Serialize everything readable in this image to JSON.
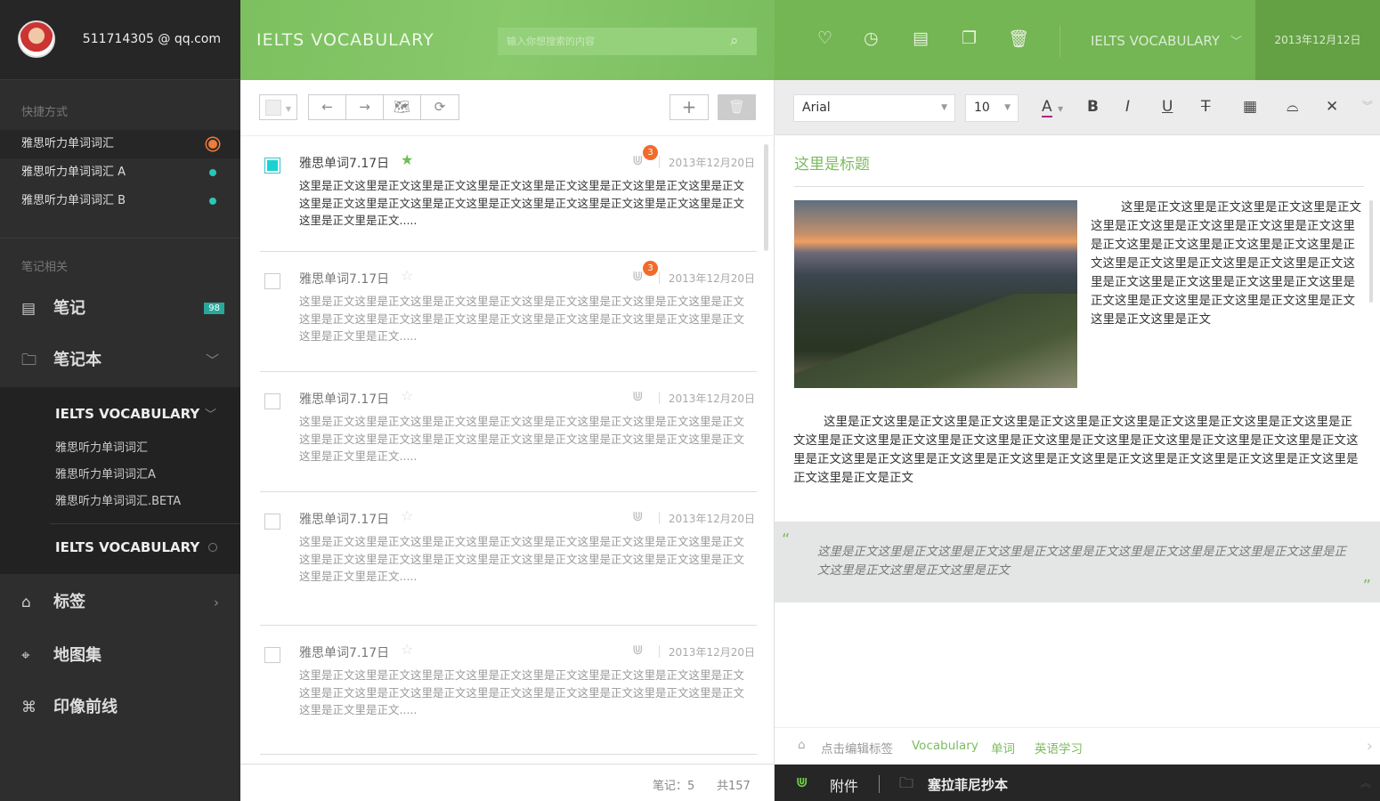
{
  "user": {
    "email": "511714305 @ qq.com"
  },
  "sidebar": {
    "quick_label": "快捷方式",
    "quick_items": [
      {
        "label": "雅思听力单词词汇"
      },
      {
        "label": "雅思听力单词词汇 A"
      },
      {
        "label": "雅思听力单词词汇 B"
      }
    ],
    "notes_label": "笔记相关",
    "notes": {
      "label": "笔记",
      "badge": "98"
    },
    "notebooks": {
      "label": "笔记本"
    },
    "notebook_groups": [
      {
        "title": "IELTS VOCABULARY",
        "items": [
          "雅思听力单词词汇",
          "雅思听力单词词汇A",
          "雅思听力单词词汇.BETA"
        ]
      },
      {
        "title": "IELTS VOCABULARY"
      }
    ],
    "tags": {
      "label": "标签"
    },
    "atlas": {
      "label": "地图集"
    },
    "shortcuts": {
      "label": "印像前线"
    }
  },
  "list": {
    "title": "IELTS VOCABULARY",
    "search_placeholder": "输入你想搜索的内容",
    "notes": [
      {
        "title": "雅思单词7.17日",
        "starred": true,
        "selected": true,
        "attachments": "3",
        "date": "2013年12月20日",
        "body": "这里是正文这里是正文这里是正文这里是正文这里是正文这里是正文这里是正文这里是正文这里是正文这里是正文这里是正文这里是正文这里是正文这里是正文这里是正文这里是正文这里是正文里是正文....."
      },
      {
        "title": "雅思单词7.17日",
        "starred": false,
        "attachments": "3",
        "date": "2013年12月20日",
        "body": "这里是正文这里是正文这里是正文这里是正文这里是正文这里是正文这里是正文这里是正文这里是正文这里是正文这里是正文这里是正文这里是正文这里是正文这里是正文这里是正文这里是正文里是正文....."
      },
      {
        "title": "雅思单词7.17日",
        "starred": false,
        "date": "2013年12月20日",
        "body": "这里是正文这里是正文这里是正文这里是正文这里是正文这里是正文这里是正文这里是正文这里是正文这里是正文这里是正文这里是正文这里是正文这里是正文这里是正文这里是正文这里是正文里是正文....."
      },
      {
        "title": "雅思单词7.17日",
        "starred": false,
        "date": "2013年12月20日",
        "body": "这里是正文这里是正文这里是正文这里是正文这里是正文这里是正文这里是正文这里是正文这里是正文这里是正文这里是正文这里是正文这里是正文这里是正文这里是正文这里是正文这里是正文里是正文....."
      },
      {
        "title": "雅思单词7.17日",
        "starred": false,
        "date": "2013年12月20日",
        "body": "这里是正文这里是正文这里是正文这里是正文这里是正文这里是正文这里是正文这里是正文这里是正文这里是正文这里是正文这里是正文这里是正文这里是正文这里是正文这里是正文这里是正文里是正文....."
      }
    ],
    "footer": {
      "count": "笔记：5",
      "total": "共157"
    }
  },
  "editor": {
    "notebook": "IELTS VOCABULARY",
    "date": "2013年12月12日",
    "font": "Arial",
    "size": "10",
    "title": "这里是标题",
    "p1": "这里是正文这里是正文这里是正文这里是正文这里是正文这里是正文这里是正文这里是正文这里是正文这里是正文这里是正文这里是正文这里是正文这里是正文这里是正文这里是正文这里是正文这里是正文这里是正文这里是正文这里是正文这里是正文这里是正文这里是正文这里是正文这里是正文这里是正文这里是正文",
    "p2": "这里是正文这里是正文这里是正文这里是正文这里是正文这里是正文这里是正文这里是正文这里是正文这里是正文这里是正文这里是正文这里是正文这里是正文这里是正文这里是正文这里是正文这里是正文这里是正文这里是正文这里是正文这里是正文这里是正文这里是正文这里是正文这里是正文这里是正文这里是正文这里是正文是正文",
    "quote": "这里是正文这里是正文这里是正文这里是正文这里是正文这里是正文这里是正文这里是正文这里是正文这里是正文这里是正文这里是正文",
    "tag_hint": "点击编辑标签",
    "tags": [
      "Vocabulary",
      "单词",
      "英语学习"
    ],
    "attach_label": "附件",
    "notebook_footer": "塞拉菲尼抄本"
  },
  "colors": {
    "accent": "#7cbc5f",
    "badge": "#f26b2b",
    "teal": "#2aa79b"
  }
}
